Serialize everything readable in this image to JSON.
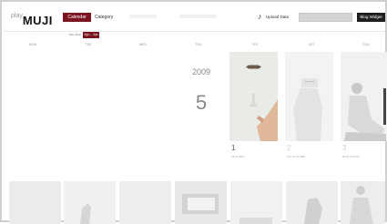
{
  "header": {
    "logo_prefix": "play",
    "logo_text": "MUJI",
    "nav": [
      {
        "label": "Calendar",
        "active": true
      },
      {
        "label": "Category",
        "active": false
      }
    ],
    "sync_label": "Upload Data",
    "blog_widget_label": "Blog Widget"
  },
  "subnav": {
    "buttons": [
      {
        "label": "Jan–Dec",
        "active": false
      },
      {
        "label": "Apr – Jun",
        "active": true
      }
    ]
  },
  "weekdays": [
    "MON",
    "TUE",
    "WED",
    "THU",
    "FRI",
    "SAT",
    "SUN"
  ],
  "date": {
    "year": "2009",
    "month": "5"
  },
  "days": [
    {
      "number": "1",
      "caption": "MUJI GELI"
    },
    {
      "number": "2",
      "caption": "OKI IN STORE"
    },
    {
      "number": "3",
      "caption": "MUJI CANNE"
    }
  ],
  "colors": {
    "accent": "#7a1420",
    "widget_bg": "#1e1e1e"
  },
  "icons": {
    "sync": "music-note-icon"
  }
}
